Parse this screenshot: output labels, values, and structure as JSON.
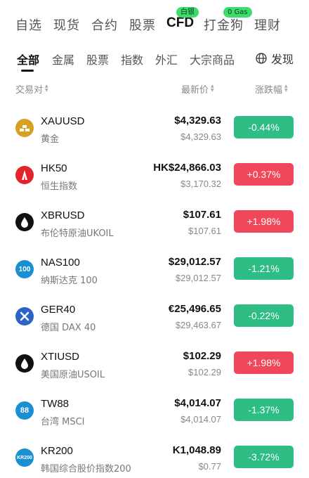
{
  "topnav": {
    "tabs": [
      "自选",
      "现货",
      "合约",
      "股票",
      "CFD",
      "打金狗",
      "理财"
    ],
    "badges": {
      "cfd": "白银",
      "dog": "0 Gas"
    }
  },
  "subnav": {
    "tabs": [
      "全部",
      "金属",
      "股票",
      "指数",
      "外汇",
      "大宗商品"
    ],
    "discover": "发现"
  },
  "header": {
    "pair": "交易对",
    "price": "最新价",
    "change": "涨跌幅"
  },
  "colors": {
    "down": "#2dbd85",
    "up": "#f0475a"
  },
  "rows": [
    {
      "symbol": "XAUUSD",
      "name": "黄金",
      "price": "$4,329.63",
      "sub": "$4,329.63",
      "change": "-0.44%",
      "dir": "down",
      "logo": "gold-bars-icon"
    },
    {
      "symbol": "HK50",
      "name": "恒生指数",
      "price": "HK$24,866.03",
      "sub": "$3,170.32",
      "change": "+0.37%",
      "dir": "up",
      "logo": "hk-building-icon"
    },
    {
      "symbol": "XBRUSD",
      "name": "布伦特原油UKOIL",
      "price": "$107.61",
      "sub": "$107.61",
      "change": "+1.98%",
      "dir": "up",
      "logo": "oil-drop-icon"
    },
    {
      "symbol": "NAS100",
      "name": "纳斯达克 100",
      "price": "$29,012.57",
      "sub": "$29,012.57",
      "change": "-1.21%",
      "dir": "down",
      "logo_text": "100"
    },
    {
      "symbol": "GER40",
      "name": "德国 DAX 40",
      "price": "€25,496.65",
      "sub": "$29,463.67",
      "change": "-0.22%",
      "dir": "down",
      "logo": "x-mark-icon"
    },
    {
      "symbol": "XTIUSD",
      "name": "美国原油USOIL",
      "price": "$102.29",
      "sub": "$102.29",
      "change": "+1.98%",
      "dir": "up",
      "logo": "oil-drop-icon"
    },
    {
      "symbol": "TW88",
      "name": "台湾 MSCI",
      "price": "$4,014.07",
      "sub": "$4,014.07",
      "change": "-1.37%",
      "dir": "down",
      "logo_text": "88"
    },
    {
      "symbol": "KR200",
      "name": "韩国综合股价指数200",
      "price": "K1,048.89",
      "sub": "$0.77",
      "change": "-3.72%",
      "dir": "down",
      "logo_text": "KR200"
    }
  ]
}
